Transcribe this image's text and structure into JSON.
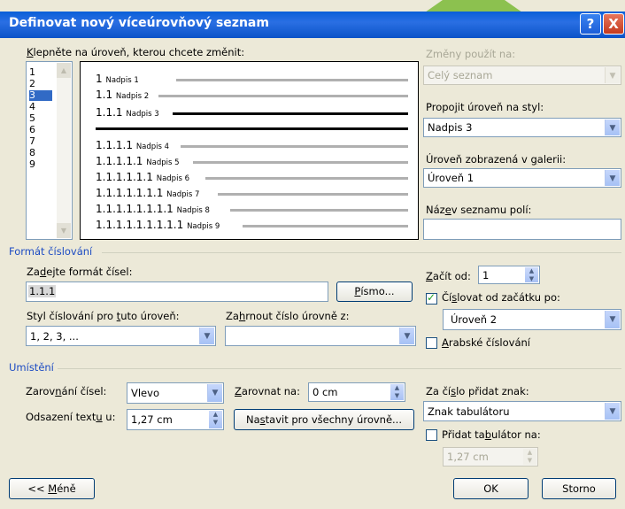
{
  "title": "Definovat nový víceúrovňový seznam",
  "titlebar": {
    "help": "?",
    "close": "X"
  },
  "levels_label_pre": "",
  "levels_label_u": "K",
  "levels_label_post": "lepněte na úroveň, kterou chcete změnit:",
  "levels": [
    "1",
    "2",
    "3",
    "4",
    "5",
    "6",
    "7",
    "8",
    "9"
  ],
  "selected_level": "3",
  "preview": [
    {
      "num": "1",
      "name": "Nadpis 1"
    },
    {
      "num": "1.1",
      "name": "Nadpis 2"
    },
    {
      "num": "1.1.1",
      "name": "Nadpis 3"
    },
    {
      "num": "1.1.1.1",
      "name": "Nadpis 4"
    },
    {
      "num": "1.1.1.1.1",
      "name": "Nadpis 5"
    },
    {
      "num": "1.1.1.1.1.1",
      "name": "Nadpis 6"
    },
    {
      "num": "1.1.1.1.1.1.1",
      "name": "Nadpis 7"
    },
    {
      "num": "1.1.1.1.1.1.1.1",
      "name": "Nadpis 8"
    },
    {
      "num": "1.1.1.1.1.1.1.1.1",
      "name": "Nadpis 9"
    }
  ],
  "right": {
    "apply_label": "Změny použít na:",
    "apply_value": "Celý seznam",
    "link_label_pre": "Propo",
    "link_label_u": "j",
    "link_label_post": "it úroveň na styl:",
    "link_value": "Nadpis 3",
    "gallery_label_pre": "Úroveň zobrazená v ",
    "gallery_label_u": "g",
    "gallery_label_post": "alerii:",
    "gallery_value": "Úroveň 1",
    "listname_label_pre": "Náz",
    "listname_label_u": "e",
    "listname_label_post": "v seznamu polí:",
    "listname_value": ""
  },
  "format": {
    "section": "Formát číslování",
    "enter_label_pre": "Za",
    "enter_label_u": "d",
    "enter_label_post": "ejte formát čísel:",
    "enter_value": "1.1.1",
    "font_btn_pre": "",
    "font_btn_u": "P",
    "font_btn_post": "ísmo...",
    "style_label_pre": "Styl číslování pro ",
    "style_label_u": "t",
    "style_label_post": "uto úroveň:",
    "style_value": "1, 2, 3, ...",
    "include_label_pre": "Za",
    "include_label_u": "h",
    "include_label_post": "rnout číslo úrovně z:",
    "include_value": "",
    "start_label_pre": "",
    "start_label_u": "Z",
    "start_label_post": "ačít od:",
    "start_value": "1",
    "restart_label_pre": "Čí",
    "restart_label_u": "s",
    "restart_label_post": "lovat od začátku po:",
    "restart_checked": "✓",
    "restart_value": "Úroveň 2",
    "legal_label_pre": "",
    "legal_label_u": "A",
    "legal_label_post": "rabské číslování"
  },
  "position": {
    "section": "Umístění",
    "align_label_pre": "Zarov",
    "align_label_u": "n",
    "align_label_post": "ání čísel:",
    "align_value": "Vlevo",
    "at_label_pre": "",
    "at_label_u": "Z",
    "at_label_post": "arovnat na:",
    "at_value": "0 cm",
    "indent_label_pre": "Odsazení text",
    "indent_label_u": "u",
    "indent_label_post": " u:",
    "indent_value": "1,27 cm",
    "setall_btn_pre": "Na",
    "setall_btn_u": "s",
    "setall_btn_post": "tavit pro všechny úrovně...",
    "follow_label_pre": "Za čí",
    "follow_label_u": "s",
    "follow_label_post": "lo přidat znak:",
    "follow_value": "Znak tabulátoru",
    "addtab_label_pre": "Přidat ta",
    "addtab_label_u": "b",
    "addtab_label_post": "ulátor na:",
    "addtab_value": "1,27 cm"
  },
  "buttons": {
    "less_pre": "<< ",
    "less_u": "M",
    "less_post": "éně",
    "ok": "OK",
    "cancel": "Storno"
  }
}
